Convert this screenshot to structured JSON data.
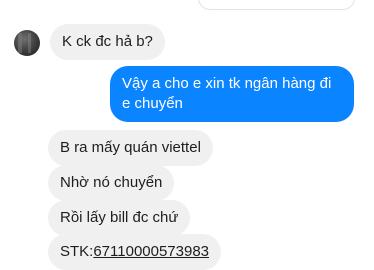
{
  "messages": [
    {
      "text": "K ck đc hả b?"
    },
    {
      "text": "Vậy a cho e xin tk ngân hàng đi e chuyển"
    },
    {
      "text": "B ra mấy quán viettel"
    },
    {
      "text": "Nhờ nó chuyển"
    },
    {
      "text": "Rồi lấy bill đc chứ"
    },
    {
      "label": "STK:",
      "account": "67110000573983"
    }
  ],
  "colors": {
    "incoming": "#f0f0f0",
    "outgoing": "#0a84ff"
  },
  "icons": {
    "avatar": "contact-avatar-icon"
  }
}
